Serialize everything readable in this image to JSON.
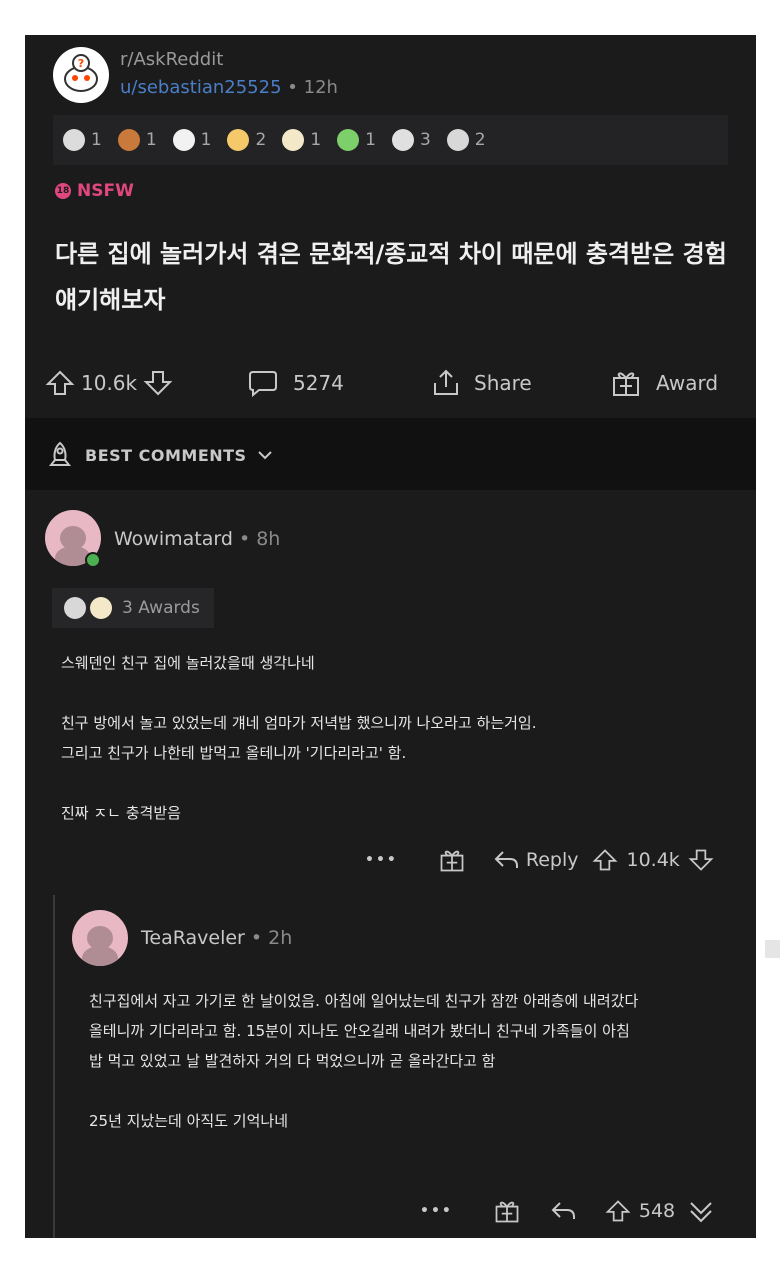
{
  "post": {
    "subreddit": "r/AskReddit",
    "username": "u/sebastian25525",
    "separator": "•",
    "age": "12h",
    "awards": [
      {
        "icon": "silver-award-icon",
        "color": "#dcdcdc",
        "count": "1"
      },
      {
        "icon": "tip-award-icon",
        "color": "#c97a3a",
        "count": "1"
      },
      {
        "icon": "bot-award-icon",
        "color": "#f2f2f2",
        "count": "1"
      },
      {
        "icon": "heart-eyes-award-icon",
        "color": "#f5c96a",
        "count": "2"
      },
      {
        "icon": "party-award-icon",
        "color": "#f3e9c8",
        "count": "1"
      },
      {
        "icon": "snake-award-icon",
        "color": "#7ccf6b",
        "count": "1"
      },
      {
        "icon": "s-coin-award-icon",
        "color": "#e0e0e0",
        "count": "3"
      },
      {
        "icon": "hug-award-icon",
        "color": "#d8d8d8",
        "count": "2"
      }
    ],
    "nsfw_label": "NSFW",
    "nsfw_badge": "18",
    "title": "다른 집에 놀러가서 겪은 문화적/종교적 차이 때문에 충격받은 경험 얘기해보자",
    "upvotes": "10.6k",
    "comments": "5274",
    "share_label": "Share",
    "award_label": "Award"
  },
  "sort": {
    "label": "BEST COMMENTS"
  },
  "comments": [
    {
      "username": "Wowimatard",
      "age": "8h",
      "awards_label": "3 Awards",
      "text": "스웨덴인 친구 집에 놀러갔을때 생각나네\n\n친구 방에서 놀고 있었는데 걔네 엄마가 저녁밥 했으니까 나오라고 하는거임.\n그리고 친구가 나한테 밥먹고 올테니까 '기다리라고' 함.\n\n진짜 ㅈㄴ 충격받음",
      "more": "•••",
      "reply_label": "Reply",
      "score": "10.4k"
    },
    {
      "username": "TeaRaveler",
      "age": "2h",
      "text": "친구집에서 자고 가기로 한 날이었음. 아침에 일어났는데 친구가 잠깐 아래층에 내려갔다\n올테니까 기다리라고 함. 15분이 지나도 안오길래 내려가 봤더니 친구네 가족들이 아침\n밥 먹고 있었고 날 발견하자 거의 다 먹었으니까 곧 올라간다고 함\n\n25년 지났는데 아직도 기억나네",
      "more": "•••",
      "score": "548"
    }
  ],
  "colors": {
    "background": "#1b1b1c",
    "username": "#4a7ec7",
    "nsfw": "#e0477e",
    "online": "#4caf50"
  }
}
